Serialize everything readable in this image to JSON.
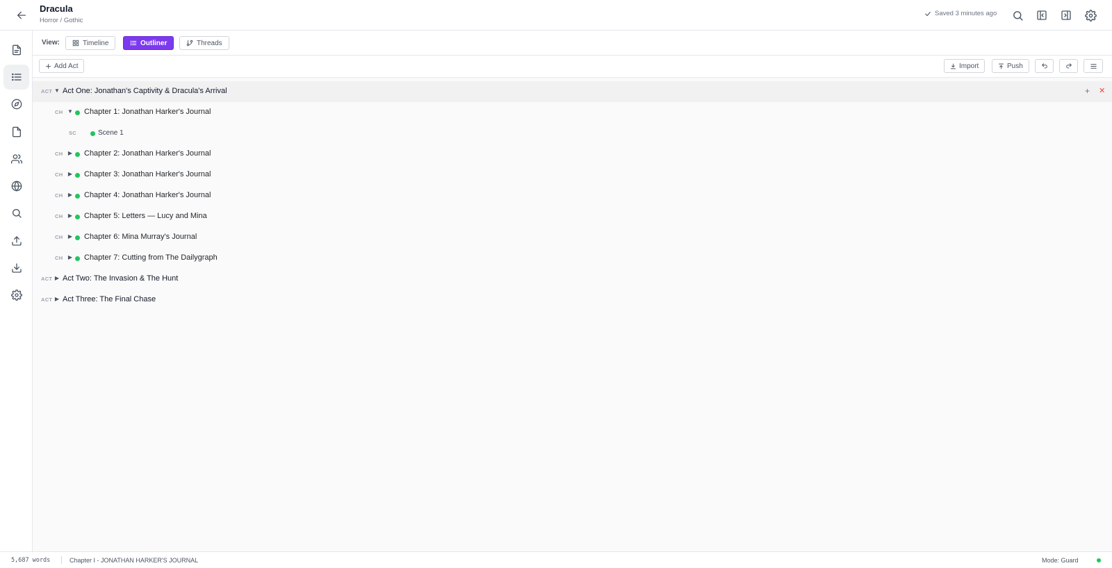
{
  "header": {
    "title": "Dracula",
    "subtitle": "Horror / Gothic",
    "save_status": "Saved 3 minutes ago"
  },
  "viewbar": {
    "label": "View:",
    "views": [
      {
        "label": "Timeline",
        "icon": "grid-icon",
        "active": false
      },
      {
        "label": "Outliner",
        "icon": "list-icon",
        "active": true
      },
      {
        "label": "Threads",
        "icon": "branch-icon",
        "active": false
      }
    ]
  },
  "toolbar": {
    "add_act": "Add Act",
    "import": "Import",
    "push": "Push"
  },
  "sidebar": {
    "items": [
      {
        "name": "document-icon",
        "active": false
      },
      {
        "name": "list-icon",
        "active": true
      },
      {
        "name": "compass-icon",
        "active": false
      },
      {
        "name": "file-icon",
        "active": false
      },
      {
        "name": "users-icon",
        "active": false
      },
      {
        "name": "globe-icon",
        "active": false
      },
      {
        "name": "search-icon",
        "active": false
      },
      {
        "name": "upload-icon",
        "active": false
      },
      {
        "name": "download-icon",
        "active": false
      },
      {
        "name": "settings-icon",
        "active": false
      }
    ]
  },
  "outline": {
    "act_tag": "ACT",
    "chapter_tag": "CH",
    "scene_tag": "SC",
    "acts": [
      {
        "title": "Act One: Jonathan's Captivity & Dracula's Arrival",
        "expanded": true,
        "chapters": [
          {
            "title": "Chapter 1: Jonathan Harker's Journal",
            "expanded": true,
            "scenes": [
              {
                "title": "Scene 1"
              }
            ]
          },
          {
            "title": "Chapter 2: Jonathan Harker's Journal",
            "expanded": false
          },
          {
            "title": "Chapter 3: Jonathan Harker's Journal",
            "expanded": false
          },
          {
            "title": "Chapter 4: Jonathan Harker's Journal",
            "expanded": false
          },
          {
            "title": "Chapter 5: Letters — Lucy and Mina",
            "expanded": false
          },
          {
            "title": "Chapter 6: Mina Murray's Journal",
            "expanded": false
          },
          {
            "title": "Chapter 7: Cutting from The Dailygraph",
            "expanded": false
          }
        ]
      },
      {
        "title": "Act Two: The Invasion & The Hunt",
        "expanded": false
      },
      {
        "title": "Act Three: The Final Chase",
        "expanded": false
      }
    ]
  },
  "statusbar": {
    "word_count": "5,687 words",
    "current_chapter": "Chapter I - JONATHAN HARKER'S JOURNAL",
    "mode": "Mode: Guard"
  },
  "colors": {
    "accent": "#7c3aed",
    "status_green": "#22c55e",
    "danger": "#ef4444"
  }
}
